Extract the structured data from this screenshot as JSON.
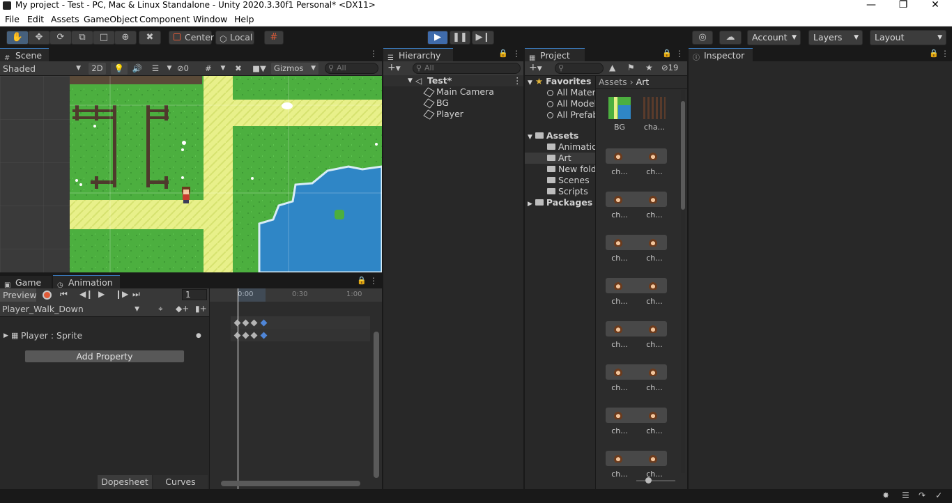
{
  "window": {
    "title": "My project - Test - PC, Mac & Linux Standalone - Unity 2020.3.30f1 Personal* <DX11>",
    "minimize": "—",
    "maximize": "❐",
    "close": "✕"
  },
  "menu": [
    "File",
    "Edit",
    "Assets",
    "GameObject",
    "Component",
    "Window",
    "Help"
  ],
  "toolbar": {
    "tools": [
      "hand-tool-icon",
      "move-tool-icon",
      "rotate-tool-icon",
      "scale-tool-icon",
      "rect-tool-icon",
      "transform-tool-icon",
      "custom-tool-icon"
    ],
    "pivot_label": "Center",
    "space_label": "Local",
    "account_label": "Account",
    "layers_label": "Layers",
    "layout_label": "Layout"
  },
  "scene": {
    "tab_label": "Scene",
    "shading_label": "Shaded",
    "mode_2d_label": "2D",
    "hidden_count": "0",
    "gizmos_label": "Gizmos",
    "search_placeholder": "All"
  },
  "hierarchy": {
    "tab_label": "Hierarchy",
    "search_placeholder": "All",
    "scene_name": "Test*",
    "objects": [
      "Main Camera",
      "BG",
      "Player"
    ]
  },
  "project": {
    "tab_label": "Project",
    "hidden_count": "19",
    "favorites_label": "Favorites",
    "favorites": [
      "All Materi",
      "All Model",
      "All Prefab"
    ],
    "assets_label": "Assets",
    "folders": [
      "Animation",
      "Art",
      "New folde",
      "Scenes",
      "Scripts"
    ],
    "packages_label": "Packages",
    "breadcrumb": [
      "Assets",
      "Art"
    ],
    "top_assets": [
      "BG",
      "cha..."
    ],
    "sprite_label": "ch..."
  },
  "inspector": {
    "tab_label": "Inspector"
  },
  "animation": {
    "game_tab_label": "Game",
    "tab_label": "Animation",
    "preview_label": "Preview",
    "frame_value": "1",
    "clip_name": "Player_Walk_Down",
    "property_label": "Player : Sprite",
    "add_property_label": "Add Property",
    "dopesheet_label": "Dopesheet",
    "curves_label": "Curves",
    "timeline_ticks": [
      "0:00",
      "0:30",
      "1:00"
    ]
  },
  "colors": {
    "accent": "#3a79bb",
    "play_button": "#3f6bab",
    "record": "#e05a37",
    "grass": "#4caf3f",
    "path": "#e8f08a",
    "water": "#2f86c6"
  }
}
